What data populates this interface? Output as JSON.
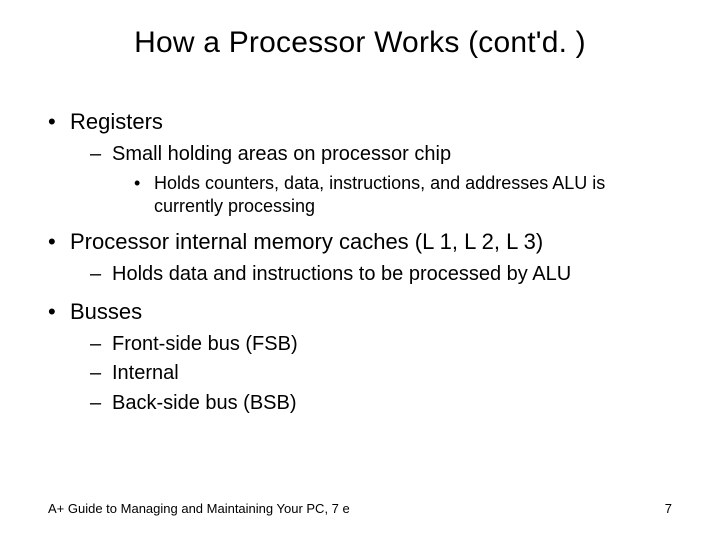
{
  "title": "How a Processor Works (cont'd. )",
  "bullets": {
    "registers": {
      "label": "Registers",
      "sub1": "Small holding areas on processor chip",
      "sub1a": "Holds counters, data, instructions, and addresses ALU is currently processing"
    },
    "caches": {
      "label": "Processor internal memory caches (L 1, L 2, L 3)",
      "sub1": "Holds data and instructions to be processed by ALU"
    },
    "busses": {
      "label": "Busses",
      "sub1": "Front-side bus (FSB)",
      "sub2": "Internal",
      "sub3": "Back-side bus (BSB)"
    }
  },
  "footer": {
    "source": "A+ Guide to Managing and Maintaining Your PC, 7 e",
    "page": "7"
  }
}
